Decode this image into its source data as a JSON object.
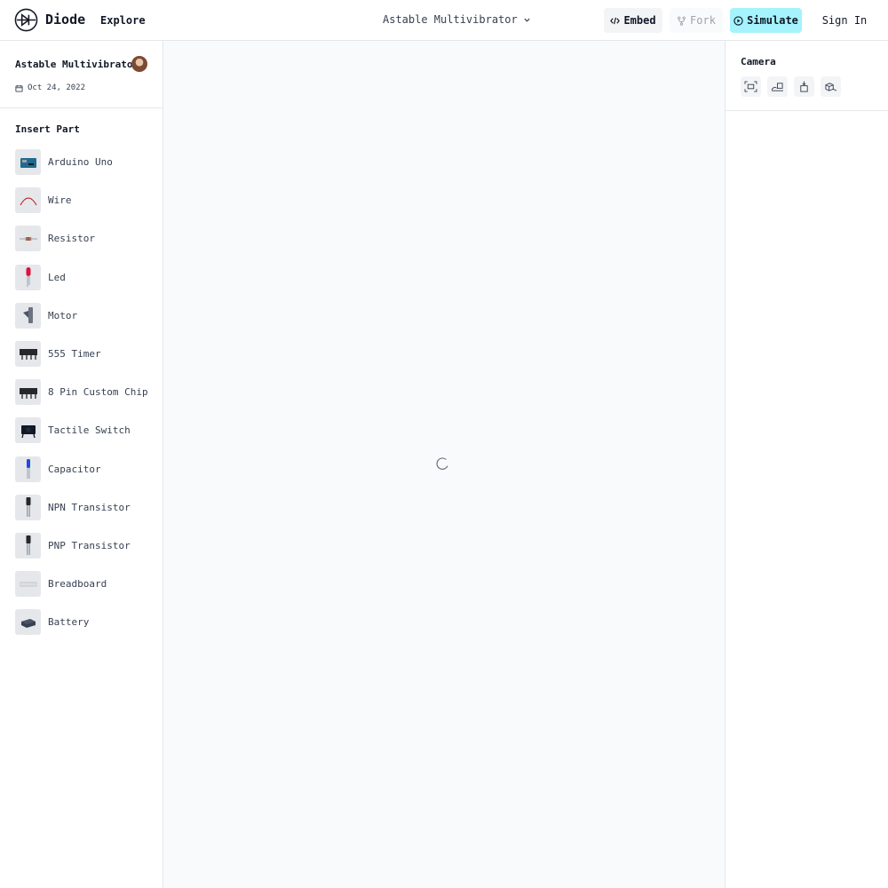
{
  "header": {
    "brand": "Diode",
    "explore_label": "Explore",
    "project_name": "Astable Multivibrator",
    "embed_label": "Embed",
    "fork_label": "Fork",
    "simulate_label": "Simulate",
    "signin_label": "Sign In"
  },
  "project": {
    "title": "Astable Multivibrator",
    "date": "Oct 24, 2022"
  },
  "insert_part": {
    "title": "Insert Part",
    "parts": [
      {
        "label": "Arduino Uno",
        "icon": "arduino-uno-icon"
      },
      {
        "label": "Wire",
        "icon": "wire-icon"
      },
      {
        "label": "Resistor",
        "icon": "resistor-icon"
      },
      {
        "label": "Led",
        "icon": "led-icon"
      },
      {
        "label": "Motor",
        "icon": "motor-icon"
      },
      {
        "label": "555 Timer",
        "icon": "555-timer-icon"
      },
      {
        "label": "8 Pin Custom Chip",
        "icon": "8-pin-custom-chip-icon"
      },
      {
        "label": "Tactile Switch",
        "icon": "tactile-switch-icon"
      },
      {
        "label": "Capacitor",
        "icon": "capacitor-icon"
      },
      {
        "label": "NPN Transistor",
        "icon": "npn-transistor-icon"
      },
      {
        "label": "PNP Transistor",
        "icon": "pnp-transistor-icon"
      },
      {
        "label": "Breadboard",
        "icon": "breadboard-icon"
      },
      {
        "label": "Battery",
        "icon": "battery-icon"
      }
    ]
  },
  "camera": {
    "title": "Camera",
    "buttons": [
      "camera-front-icon",
      "camera-side-icon",
      "camera-top-icon",
      "camera-iso-icon"
    ]
  },
  "colors": {
    "accent": "#a5f3fc",
    "canvas_bg": "#f9fafb",
    "border": "#e5e7eb"
  }
}
